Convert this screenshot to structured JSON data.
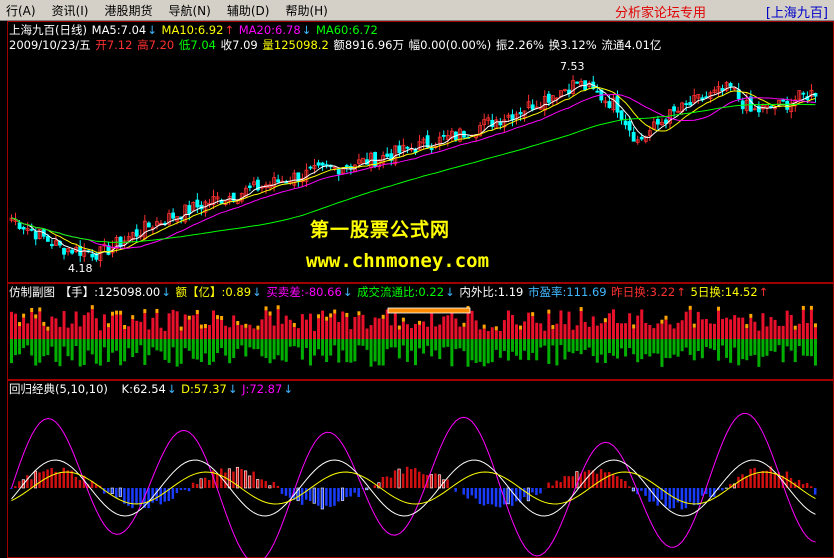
{
  "menu": {
    "items": [
      "行(A)",
      "资讯(I)",
      "港股期货",
      "导航(N)",
      "辅助(D)",
      "帮助(H)"
    ],
    "brand": "分析家论坛专用",
    "brand_stock": "[上海九百]"
  },
  "main": {
    "title": "上海九百(日线)",
    "ma5": "MA5:7.04",
    "ma10": "MA10:6.92",
    "ma20": "MA20:6.78",
    "ma60": "MA60:6.72",
    "date": "2009/10/23/五",
    "open": "开7.12",
    "high": "高7.20",
    "low": "低7.04",
    "close": "收7.09",
    "vol": "量125098.2",
    "amount": "额8916.96万",
    "change": "幅0.00(0.00%)",
    "amp": "振2.26%",
    "turnover": "换3.12%",
    "float": "流通4.01亿",
    "max_label": "7.53",
    "min_label": "4.18",
    "watermark1": "第一股票公式网",
    "watermark2": "www.chnmoney.com"
  },
  "sub1": {
    "name": "仿制副图",
    "vol": "【手】:125098.00",
    "amt": "额【亿】:0.89",
    "diff": "买卖差:-80.66",
    "flow": "成交流通比:0.22",
    "inout": "内外比:1.19",
    "pe": "市盈率:111.69",
    "yest": "昨日换:3.22",
    "five": "5日换:14.52"
  },
  "sub2": {
    "name": "回归经典(5,10,10)",
    "k": "K:62.54",
    "d": "D:57.37",
    "j": "J:72.87"
  },
  "colors": {
    "up": "#ff3030",
    "down": "#00ffff",
    "ma5": "#ffffff",
    "ma10": "#ffff00",
    "ma20": "#ff00ff",
    "ma60": "#00ff00",
    "vol_up": "#e8102a",
    "vol_dn": "#00b000"
  }
}
